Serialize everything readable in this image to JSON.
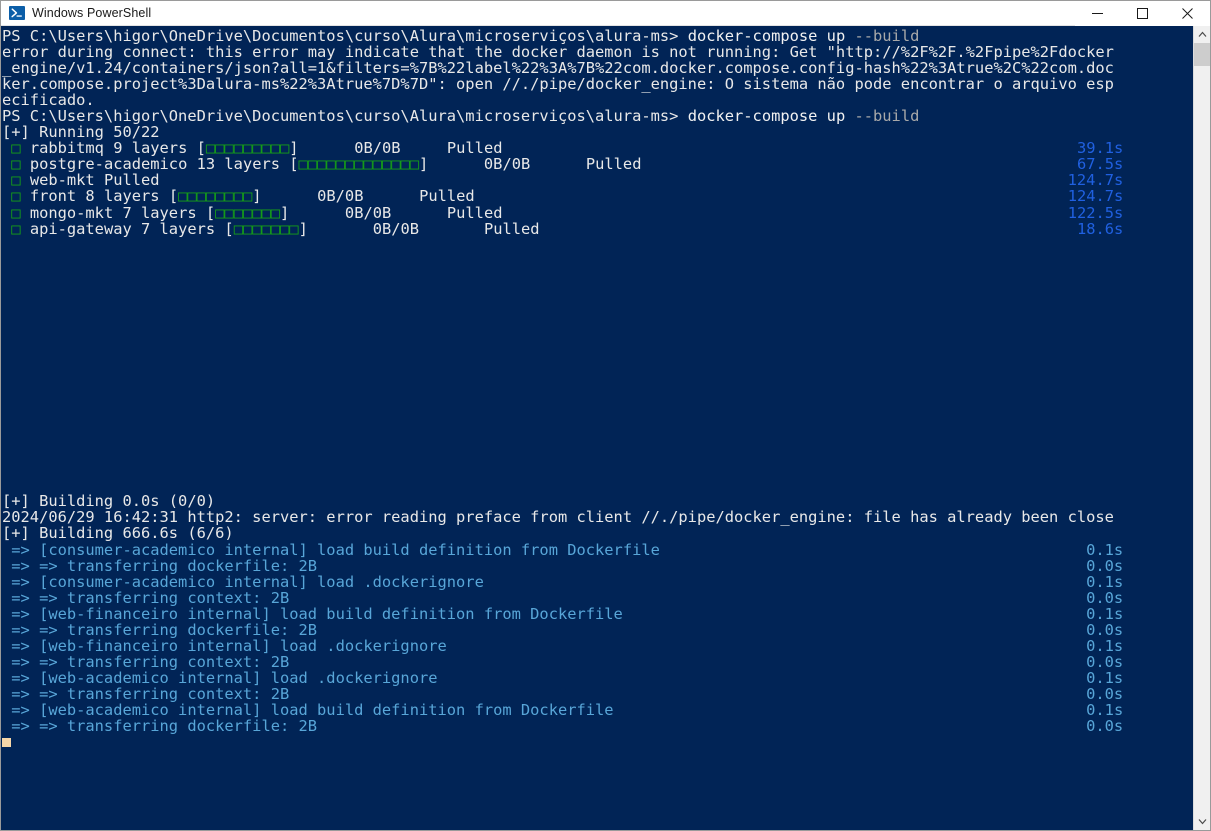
{
  "window": {
    "title": "Windows PowerShell",
    "icon": "powershell-icon",
    "controls": {
      "minimize": "minimize-icon",
      "maximize": "maximize-icon",
      "close": "close-icon"
    }
  },
  "colors": {
    "background": "#012456",
    "default_text": "#e8e8e8",
    "gray_text": "#a9a9a9",
    "green": "#16a016",
    "blue": "#2060e0",
    "cyan": "#58a6d8",
    "cursor": "#f7d7a8",
    "titlebar": "#ffffff",
    "scrollbar_track": "#f0f0f0",
    "scrollbar_thumb": "#cdcdcd"
  },
  "terminal": {
    "prompt1": {
      "path": "PS C:\\Users\\higor\\OneDrive\\Documentos\\curso\\Alura\\microserviços\\alura-ms> ",
      "command": "docker-compose up ",
      "flag": "--build"
    },
    "error_lines": [
      "error during connect: this error may indicate that the docker daemon is not running: Get \"http://%2F%2F.%2Fpipe%2Fdocker",
      "_engine/v1.24/containers/json?all=1&filters=%7B%22label%22%3A%7B%22com.docker.compose.config-hash%22%3Atrue%2C%22com.doc",
      "ker.compose.project%3Dalura-ms%22%3Atrue%7D%7D\": open //./pipe/docker_engine: O sistema não pode encontrar o arquivo esp",
      "ecificado."
    ],
    "prompt2": {
      "path": "PS C:\\Users\\higor\\OneDrive\\Documentos\\curso\\Alura\\microserviços\\alura-ms> ",
      "command": "docker-compose up ",
      "flag": "--build"
    },
    "running_header": "[+] Running 50/22",
    "services": [
      {
        "check": "□",
        "name": " rabbitmq 9 layers ",
        "bracket_open": "[",
        "blocks": "□□□□□□□□□",
        "bracket_close": "]",
        "gap1": "      ",
        "size": "0B/0B",
        "gap2": "     ",
        "status": "Pulled",
        "time": "39.1s"
      },
      {
        "check": "□",
        "name": " postgre-academico 13 layers ",
        "bracket_open": "[",
        "blocks": "□□□□□□□□□□□□□",
        "bracket_close": "]",
        "gap1": "      ",
        "size": "0B/0B",
        "gap2": "      ",
        "status": "Pulled",
        "time": "67.5s"
      },
      {
        "check": "□",
        "name": " web-mkt ",
        "bracket_open": "",
        "blocks": "",
        "bracket_close": "",
        "gap1": "",
        "size": "",
        "gap2": "",
        "status": "Pulled",
        "time": "124.7s"
      },
      {
        "check": "□",
        "name": " front 8 layers ",
        "bracket_open": "[",
        "blocks": "□□□□□□□□",
        "bracket_close": "]",
        "gap1": "      ",
        "size": "0B/0B",
        "gap2": "      ",
        "status": "Pulled",
        "time": "124.7s"
      },
      {
        "check": "□",
        "name": " mongo-mkt 7 layers ",
        "bracket_open": "[",
        "blocks": "□□□□□□□",
        "bracket_close": "]",
        "gap1": "      ",
        "size": "0B/0B",
        "gap2": "      ",
        "status": "Pulled",
        "time": "122.5s"
      },
      {
        "check": "□",
        "name": " api-gateway 7 layers ",
        "bracket_open": "[",
        "blocks": "□□□□□□□",
        "bracket_close": "]",
        "gap1": "       ",
        "size": "0B/0B",
        "gap2": "       ",
        "status": "Pulled",
        "time": "18.6s"
      }
    ],
    "building_header_1": "[+] Building 0.0s (0/0)",
    "http2_error": "2024/06/29 16:42:31 http2: server: error reading preface from client //./pipe/docker_engine: file has already been close",
    "building_header_2": "[+] Building 666.6s (6/6)",
    "build_steps": [
      {
        "text": " => [consumer-academico internal] load build definition from Dockerfile",
        "time": "0.1s"
      },
      {
        "text": " => => transferring dockerfile: 2B",
        "time": "0.0s"
      },
      {
        "text": " => [consumer-academico internal] load .dockerignore",
        "time": "0.1s"
      },
      {
        "text": " => => transferring context: 2B",
        "time": "0.0s"
      },
      {
        "text": " => [web-financeiro internal] load build definition from Dockerfile",
        "time": "0.1s"
      },
      {
        "text": " => => transferring dockerfile: 2B",
        "time": "0.0s"
      },
      {
        "text": " => [web-financeiro internal] load .dockerignore",
        "time": "0.1s"
      },
      {
        "text": " => => transferring context: 2B",
        "time": "0.0s"
      },
      {
        "text": " => [web-academico internal] load .dockerignore",
        "time": "0.1s"
      },
      {
        "text": " => => transferring context: 2B",
        "time": "0.0s"
      },
      {
        "text": " => [web-academico internal] load build definition from Dockerfile",
        "time": "0.1s"
      },
      {
        "text": " => => transferring dockerfile: 2B",
        "time": "0.0s"
      }
    ]
  }
}
